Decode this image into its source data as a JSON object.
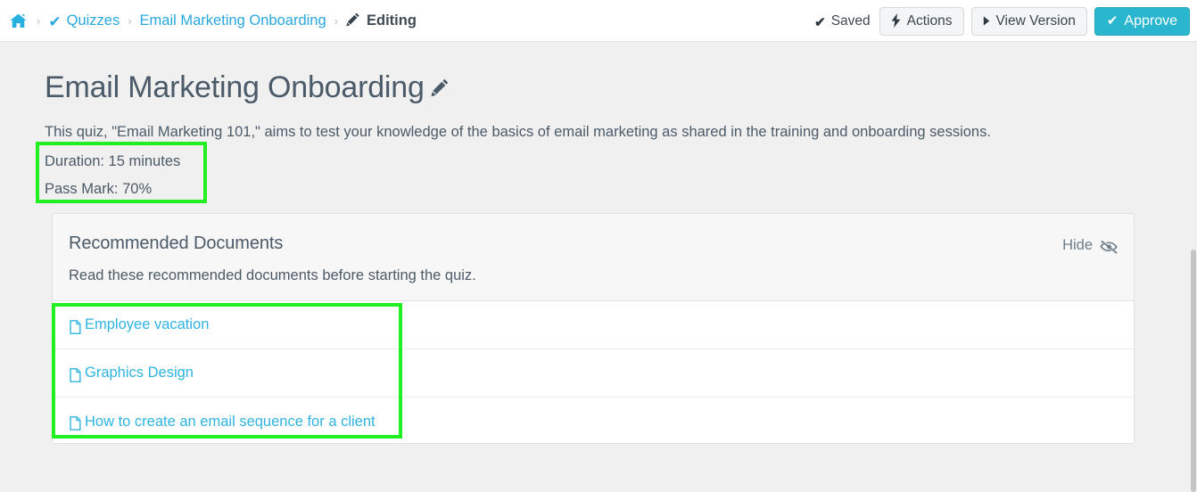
{
  "breadcrumb": {
    "home_icon": "home-icon",
    "separator": "›",
    "items": [
      {
        "label": "Quizzes",
        "icon": "check-icon",
        "type": "link"
      },
      {
        "label": "Email Marketing Onboarding",
        "icon": "",
        "type": "link"
      },
      {
        "label": "Editing",
        "icon": "pencil-icon",
        "type": "current"
      }
    ]
  },
  "topactions": {
    "saved_label": "Saved",
    "saved_icon": "check-icon",
    "actions_label": "Actions",
    "actions_icon": "bolt-icon",
    "view_version_label": "View Version",
    "view_version_icon": "caret-right-icon",
    "approve_label": "Approve",
    "approve_icon": "check-icon"
  },
  "page": {
    "title": "Email Marketing Onboarding",
    "title_edit_icon": "pencil-icon",
    "description": "This quiz, \"Email Marketing 101,\" aims to test your knowledge of the basics of email marketing as shared in the training and onboarding sessions.",
    "duration": "Duration: 15 minutes",
    "pass_mark": "Pass Mark: 70%"
  },
  "card": {
    "title": "Recommended Documents",
    "subtitle": "Read these recommended documents before starting the quiz.",
    "hide_label": "Hide",
    "hide_icon": "eye-slash-icon",
    "documents": [
      {
        "label": "Employee vacation",
        "icon": "file-icon"
      },
      {
        "label": "Graphics Design",
        "icon": "file-icon"
      },
      {
        "label": "How to create an email sequence for a client",
        "icon": "file-icon"
      }
    ]
  },
  "colors": {
    "link": "#2fb4e0",
    "primary": "#29b6ce",
    "text": "#4c5a68",
    "highlight": "#22ee22",
    "page_bg": "#f0f0f0",
    "card_header_bg": "#f7f7f7"
  }
}
